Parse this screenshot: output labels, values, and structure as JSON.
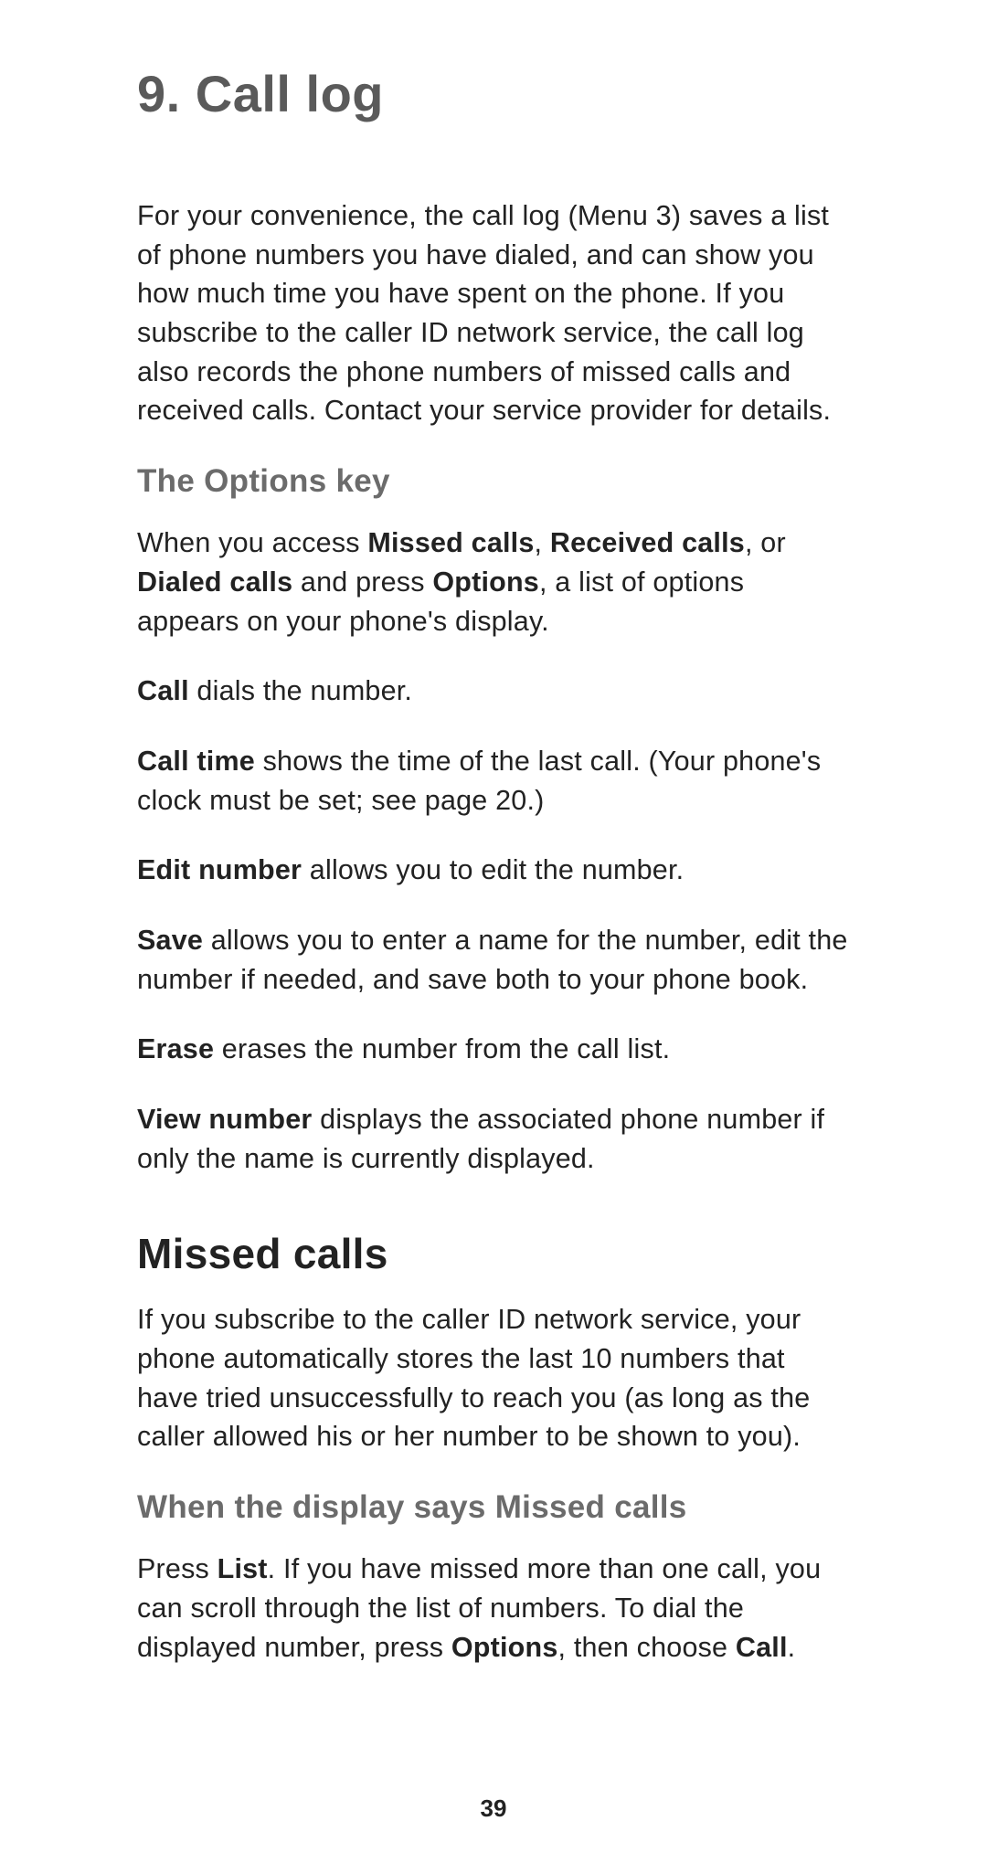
{
  "chapter_title": "9. Call log",
  "intro": "For your convenience, the call log (Menu 3) saves a list of phone numbers you have dialed, and can show you how much time you have spent on the phone. If you subscribe to the caller ID network service, the call log also records the phone numbers of missed calls and received calls. Contact your service provider for details.",
  "options_key": {
    "heading": "The Options key",
    "intro_pre": "When you access ",
    "b_missed": "Missed calls",
    "sep1": ", ",
    "b_received": "Received calls",
    "sep2": ", or ",
    "b_dialed": "Dialed calls",
    "intro_mid": " and press ",
    "b_options": "Options",
    "intro_post": ", a list of options appears on your phone's display.",
    "call_b": "Call",
    "call_rest": " dials the number.",
    "calltime_b": "Call time",
    "calltime_rest": " shows the time of the last call. (Your phone's clock must be set; see page 20.)",
    "edit_b": "Edit number",
    "edit_rest": " allows you to edit the number.",
    "save_b": "Save",
    "save_rest": " allows you to enter a name for the number, edit the number if needed, and save both to your phone book.",
    "erase_b": "Erase",
    "erase_rest": " erases the number from the call list.",
    "view_b": "View number",
    "view_rest": " displays the associated phone number if only the name is currently displayed."
  },
  "missed": {
    "heading": "Missed calls",
    "intro": "If you subscribe to the caller ID network service, your phone automatically stores the last 10 numbers that have tried unsuccessfully to reach you (as long as the caller allowed his or her number to be shown to you).",
    "sub_heading": "When the display says Missed calls",
    "press_pre": "Press ",
    "b_list": "List",
    "press_mid": ". If you have missed more than one call, you can scroll through the list of numbers. To dial the displayed number, press ",
    "b_options": "Options",
    "press_mid2": ", then choose ",
    "b_call": "Call",
    "press_post": "."
  },
  "page_number": "39"
}
